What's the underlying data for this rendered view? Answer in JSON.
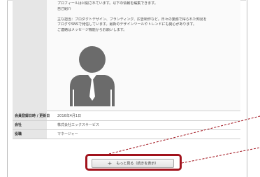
{
  "profile": {
    "description_lines": [
      "プロフィールは公開されています。以下の情報を編集できます。",
      "自己紹介",
      "主な担当：プロダクトデザイン、ブランディング、広告制作など。日々の業務で得られた知見を",
      "ブログやSNSで発信しています。最新のデザインツールやトレンドにも関心があります。",
      "ご連絡はメッセージ機能からお願いします。"
    ],
    "fields": [
      {
        "label": "会員登録日時 / 更新日",
        "value": "2016年4月1日"
      },
      {
        "label": "会社",
        "value": "株式会社エックスサービス"
      },
      {
        "label": "役職",
        "value": "マネージャー"
      }
    ]
  },
  "actions": {
    "more_label": "もっと見る（続きを表示）"
  },
  "colors": {
    "highlight": "#a1121c",
    "avatar": "#6b6b6b"
  }
}
